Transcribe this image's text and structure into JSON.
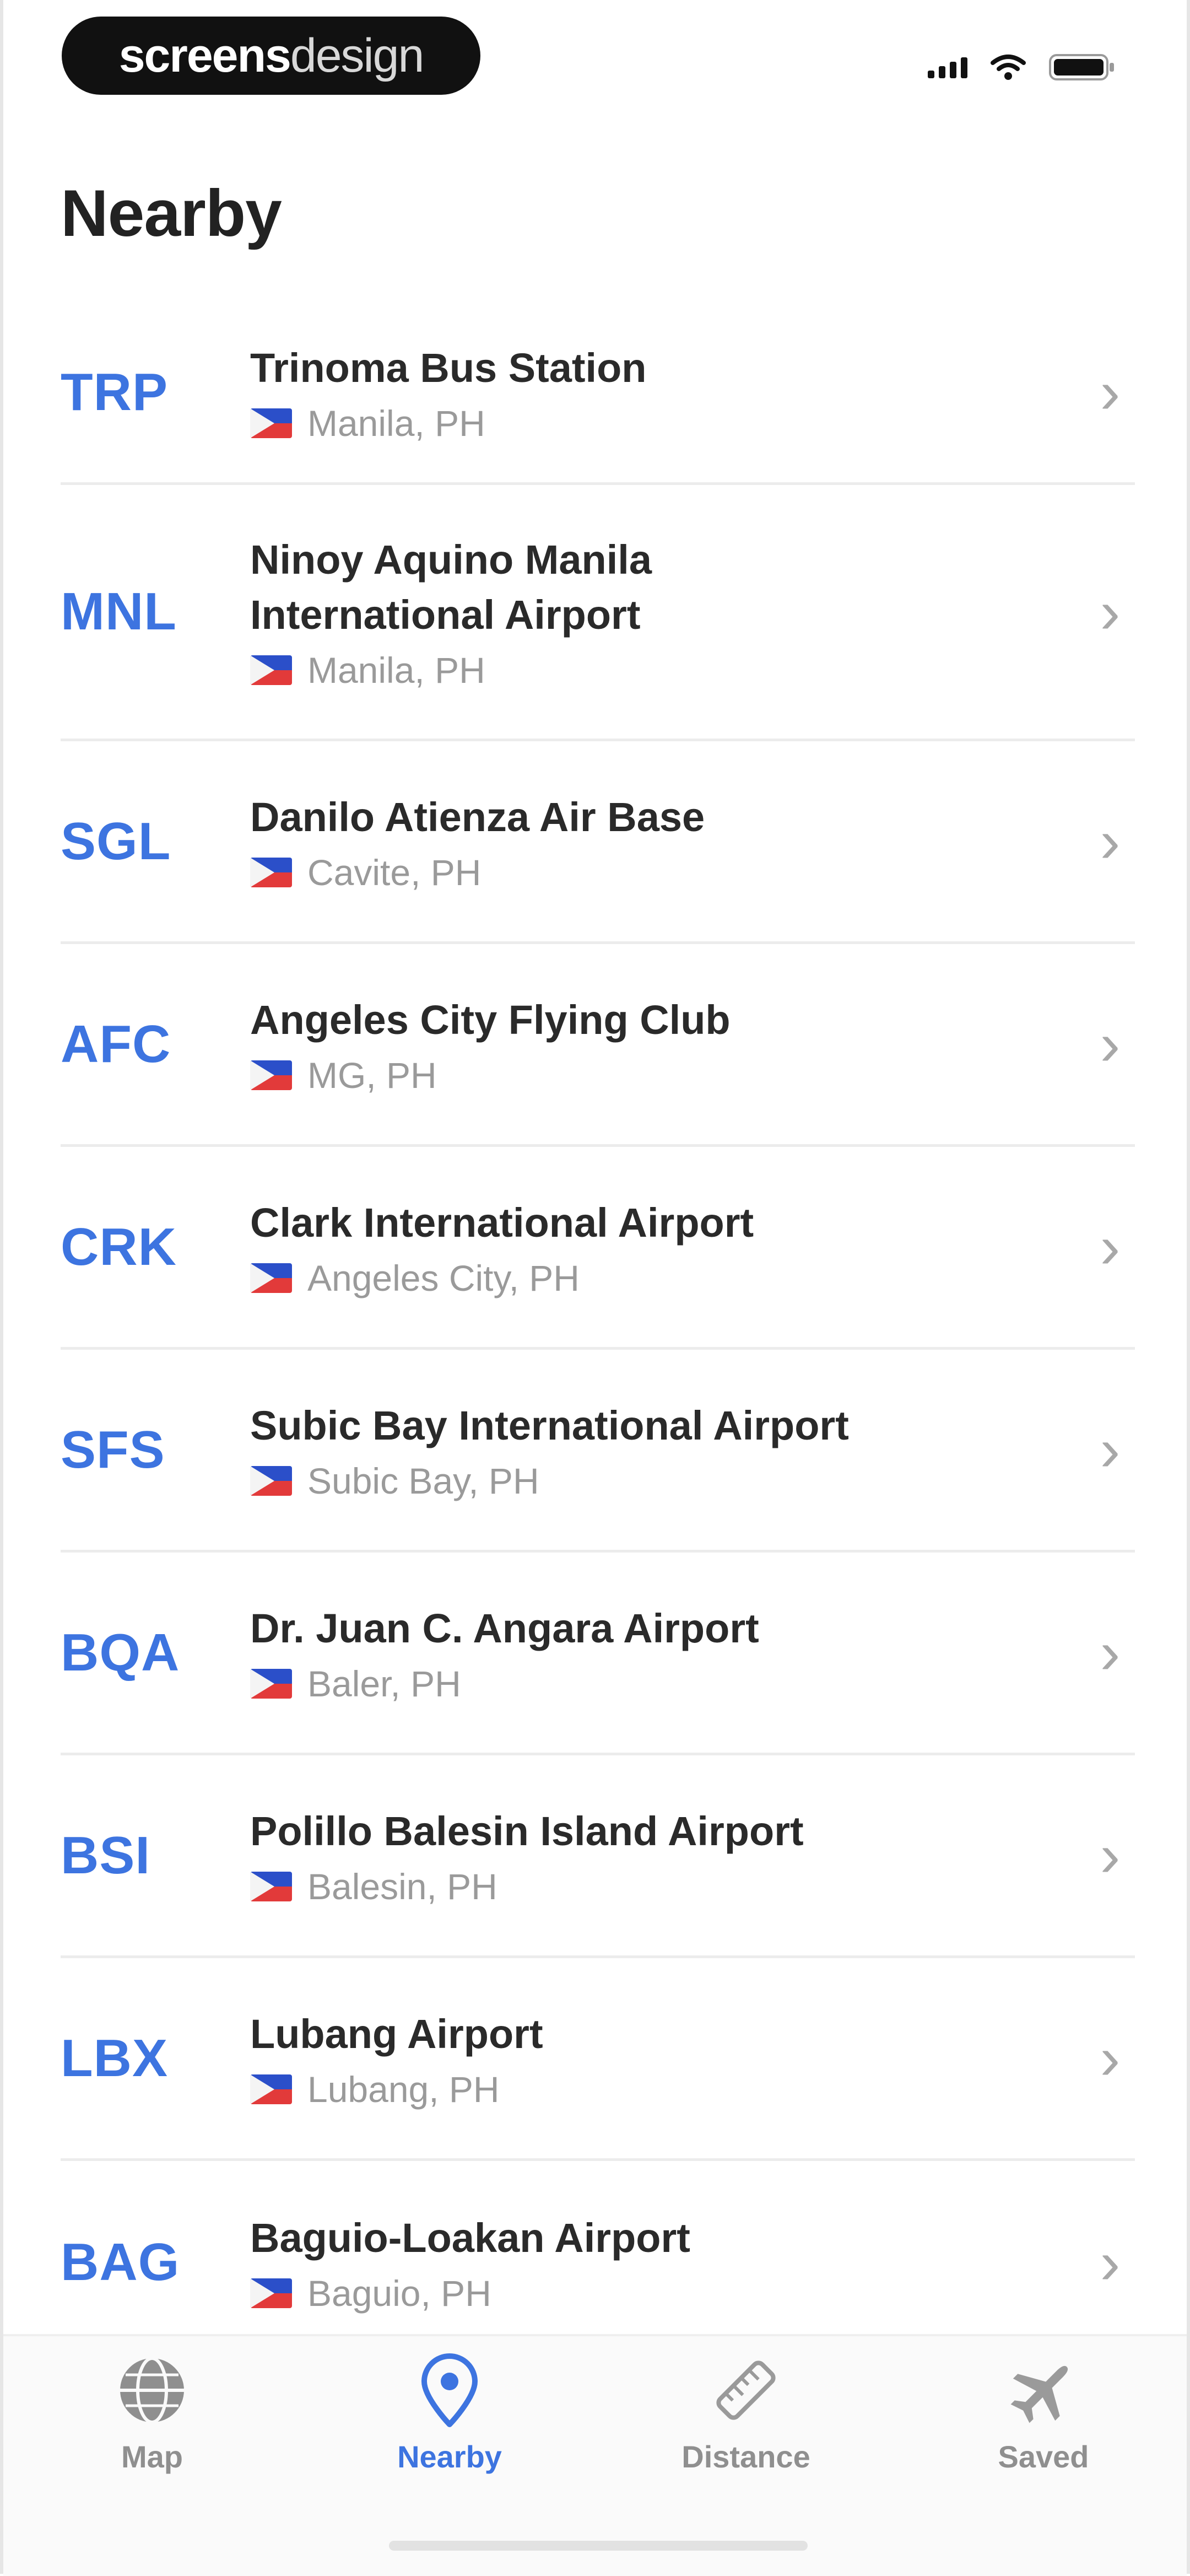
{
  "status_bar": {
    "brand_bold": "screens",
    "brand_light": "design"
  },
  "header": {
    "title": "Nearby"
  },
  "airports": [
    {
      "code": "TRP",
      "name": "Trinoma Bus Station",
      "location": "Manila, PH"
    },
    {
      "code": "MNL",
      "name": "Ninoy Aquino Manila International Airport",
      "location": "Manila, PH"
    },
    {
      "code": "SGL",
      "name": "Danilo Atienza Air Base",
      "location": "Cavite, PH"
    },
    {
      "code": "AFC",
      "name": "Angeles City Flying Club",
      "location": "MG, PH"
    },
    {
      "code": "CRK",
      "name": "Clark International Airport",
      "location": "Angeles City, PH"
    },
    {
      "code": "SFS",
      "name": "Subic Bay International Airport",
      "location": "Subic Bay, PH"
    },
    {
      "code": "BQA",
      "name": "Dr. Juan C. Angara Airport",
      "location": "Baler, PH"
    },
    {
      "code": "BSI",
      "name": "Polillo Balesin Island Airport",
      "location": "Balesin, PH"
    },
    {
      "code": "LBX",
      "name": "Lubang Airport",
      "location": "Lubang, PH"
    },
    {
      "code": "BAG",
      "name": "Baguio-Loakan Airport",
      "location": "Baguio, PH"
    }
  ],
  "tab_bar": {
    "tabs": [
      {
        "label": "Map",
        "icon": "globe-icon",
        "active": false
      },
      {
        "label": "Nearby",
        "icon": "location-pin-icon",
        "active": true
      },
      {
        "label": "Distance",
        "icon": "ruler-icon",
        "active": false
      },
      {
        "label": "Saved",
        "icon": "airplane-icon",
        "active": false
      }
    ]
  },
  "colors": {
    "accent": "#3d74e0",
    "text": "#2a2a2a",
    "muted": "#9a9a9a",
    "divider": "#ececec"
  }
}
